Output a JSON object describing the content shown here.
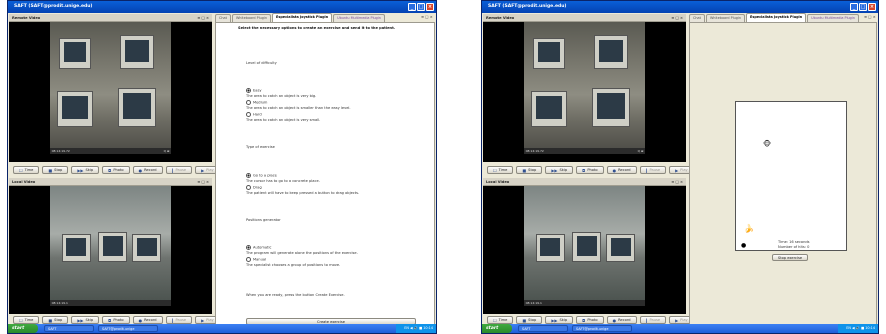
{
  "window": {
    "title": "SAFT (SAFT@prodit.unige.edu)"
  },
  "panels": {
    "remote_video": {
      "title": "Remote Video",
      "controls": "≡ □ ×",
      "timestamp": "08:14:19.72",
      "zoom": "Q ⊞"
    },
    "local_video": {
      "title": "Local Video",
      "controls": "≡ □ ×",
      "timestamp": "08:14:19.1"
    }
  },
  "video_buttons": {
    "time": "Time",
    "stop": "Stop",
    "skip": "Skip",
    "photo": "Photo",
    "record": "Record",
    "pause": "Pause",
    "play": "Play"
  },
  "tabs": [
    {
      "label": "Chat"
    },
    {
      "label": "Whiteboard Plugin"
    },
    {
      "label": "Especialista Joystick Plugin"
    },
    {
      "label": "Ubuntu Multimedia Plugin"
    }
  ],
  "tab_controls": "≡ □ ×",
  "form": {
    "heading": "Select the necessary options to create an exercise and send it to the patient.",
    "difficulty_title": "Level of difficulty",
    "difficulty_options": [
      {
        "label": "Easy",
        "desc": "The area to catch an object is very big."
      },
      {
        "label": "Medium",
        "desc": "The area to catch an object is smaller than the easy level."
      },
      {
        "label": "Hard",
        "desc": "The area to catch an object is very small."
      }
    ],
    "type_title": "Type of exercise",
    "type_options": [
      {
        "label": "Go to a place",
        "desc": "The cursor has to go to a concrete place."
      },
      {
        "label": "Drag",
        "desc": "The patient will have to keep pressed a button to drag objects."
      }
    ],
    "positions_title": "Positions generator",
    "positions_options": [
      {
        "label": "Automatic",
        "desc": "The program will generate alone the positions of the exercise."
      },
      {
        "label": "Manual",
        "desc": "The specialist chooses a group of positions to move."
      }
    ],
    "ready_text": "When you are ready, press the button Create Exercise.",
    "create_button": "Create exercise"
  },
  "game": {
    "time_text": "Time: 16 seconds",
    "hits_text": "Number of hits: 0",
    "stop_button": "Stop exercise"
  },
  "taskbar": {
    "start": "start",
    "task1": "SAFT",
    "task2": "SAFT@prodit.unige",
    "clock": "EN  ◀ 🔊 ■ 10:14"
  }
}
